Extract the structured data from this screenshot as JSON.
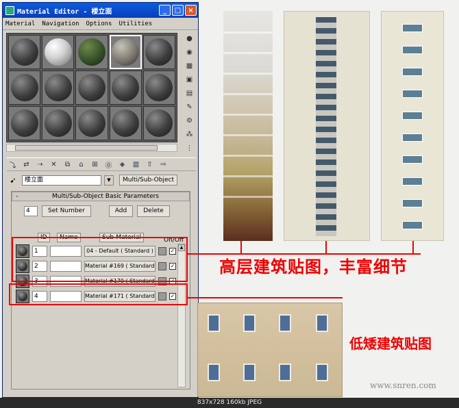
{
  "window": {
    "title": "Material Editor - 楼立面",
    "minimize": "_",
    "maximize": "□",
    "close": "×"
  },
  "menu": [
    "Material",
    "Navigation",
    "Options",
    "Utilities"
  ],
  "material_name": "楼立面",
  "material_type": "Multi/Sub-Object",
  "rollout": {
    "title": "Multi/Sub-Object Basic Parameters",
    "collapse": "-",
    "count": "4",
    "set_number": "Set Number",
    "add": "Add",
    "delete": "Delete",
    "col_id": "ID",
    "col_name": "Name",
    "col_sub": "Sub-Material",
    "col_onoff": "On/Off"
  },
  "rows": [
    {
      "id": "1",
      "sub": "04 - Default  ( Standard )",
      "on": true
    },
    {
      "id": "2",
      "sub": "Material #169  ( Standard )",
      "on": true
    },
    {
      "id": "3",
      "sub": "Material #170  ( Standard )",
      "on": true
    },
    {
      "id": "4",
      "sub": "Material #171  ( Standard )",
      "on": true
    }
  ],
  "captions": {
    "high": "高层建筑贴图，丰富细节",
    "low": "低矮建筑贴图"
  },
  "watermark": "www.snren.com",
  "info": "837x728  160kb  JPEG",
  "colors": {
    "annotation": "#e00000",
    "title_bar": "#0a3fb8"
  }
}
